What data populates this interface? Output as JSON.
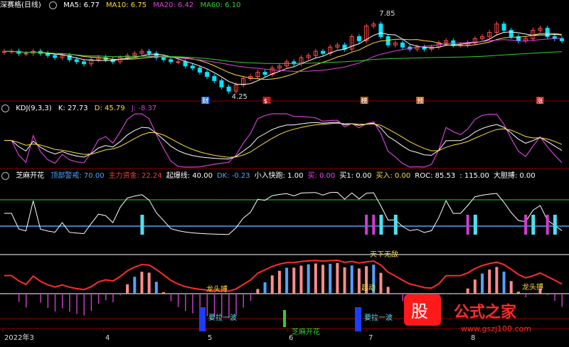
{
  "panel1": {
    "title": "深赛格(日线)",
    "ma5_label": "MA5: 6.77",
    "ma10_label": "MA10: 6.75",
    "ma20_label": "MA20: 6.42",
    "ma60_label": "MA60: 6.10",
    "high_label": "7.85",
    "low_label": "4.25",
    "markers": [
      "财",
      "$",
      "榜",
      "预",
      "涨"
    ]
  },
  "panel2": {
    "title": "KDJ(9,3,3)",
    "k_label": "K: 27.73",
    "d_label": "D: 45.79",
    "j_label": "J: -8.37"
  },
  "panel3": {
    "title": "芝麻开花",
    "items": [
      {
        "text": "顶部警戒: 70.00",
        "color": "#4fa3ff"
      },
      {
        "text": "主力资金: 22.24",
        "color": "#ff3b3b"
      },
      {
        "text": "起爆线: 40.00",
        "color": "#ffffff"
      },
      {
        "text": "DK: -0.23",
        "color": "#4fa3ff"
      },
      {
        "text": "小入快跑: 1.00",
        "color": "#ffffff"
      },
      {
        "text": "买: 0.00",
        "color": "#ff3bff"
      },
      {
        "text": "买1: 0.00",
        "color": "#ffffff"
      },
      {
        "text": "买入: 0.00",
        "color": "#ffdc3b"
      },
      {
        "text": "ROC: 85.53",
        "color": "#ffffff"
      },
      {
        "text": ": 115.00",
        "color": "#ffffff"
      },
      {
        "text": "大胆搏: 0.00",
        "color": "#ffffff"
      }
    ],
    "annotations": {
      "tianxia": "天下无敌",
      "longtou1": "龙头搏",
      "longtou2": "龙头搏",
      "qidong": "起动",
      "yaola1": "要拉一波",
      "yaola2": "要拉一波",
      "zhima": "芝麻开花"
    }
  },
  "axis": {
    "dates": [
      "2022年3",
      "4",
      "5",
      "6",
      "7",
      "8"
    ]
  },
  "watermark": {
    "cn": "公式之家",
    "url": "www.gszj100.com"
  },
  "colors": {
    "up": "#ff4b4b",
    "down": "#00e5ff",
    "ma5": "#ffffff",
    "ma10": "#ffdc3b",
    "ma20": "#e040e0",
    "ma60": "#2fcf2f",
    "k": "#ffffff",
    "d": "#ffdc3b",
    "j": "#d040d0"
  },
  "chart_data": [
    {
      "type": "candlestick",
      "title": "深赛格(日线)",
      "series": [
        {
          "name": "MA5",
          "last": 6.77
        },
        {
          "name": "MA10",
          "last": 6.75
        },
        {
          "name": "MA20",
          "last": 6.42
        },
        {
          "name": "MA60",
          "last": 6.1
        }
      ],
      "annotations": [
        {
          "text": "7.85",
          "kind": "high"
        },
        {
          "text": "4.25",
          "kind": "low"
        }
      ],
      "ylim": [
        4.0,
        8.2
      ],
      "close": [
        6.3,
        6.3,
        6.2,
        6.2,
        6.3,
        6.2,
        6.1,
        6.0,
        6.1,
        5.9,
        5.8,
        5.7,
        5.9,
        6.0,
        5.9,
        5.8,
        6.0,
        6.1,
        6.2,
        6.3,
        6.2,
        6.0,
        5.9,
        5.8,
        5.8,
        5.6,
        5.5,
        5.3,
        5.1,
        4.9,
        4.6,
        4.4,
        4.7,
        5.0,
        5.1,
        5.3,
        5.2,
        5.5,
        5.6,
        5.8,
        5.7,
        6.0,
        6.1,
        6.3,
        6.2,
        6.5,
        6.6,
        6.4,
        7.0,
        6.8,
        7.5,
        7.6,
        7.0,
        6.6,
        6.7,
        6.5,
        6.4,
        6.5,
        6.4,
        6.5,
        6.7,
        6.8,
        6.6,
        6.6,
        6.7,
        6.9,
        7.0,
        7.2,
        7.6,
        7.3,
        7.0,
        6.8,
        6.9,
        7.3,
        7.4,
        7.0,
        6.9,
        6.8
      ],
      "kdj": {
        "series": [
          "K",
          "D",
          "J"
        ],
        "last": {
          "K": 27.73,
          "D": 45.79,
          "J": -8.37
        }
      }
    }
  ]
}
